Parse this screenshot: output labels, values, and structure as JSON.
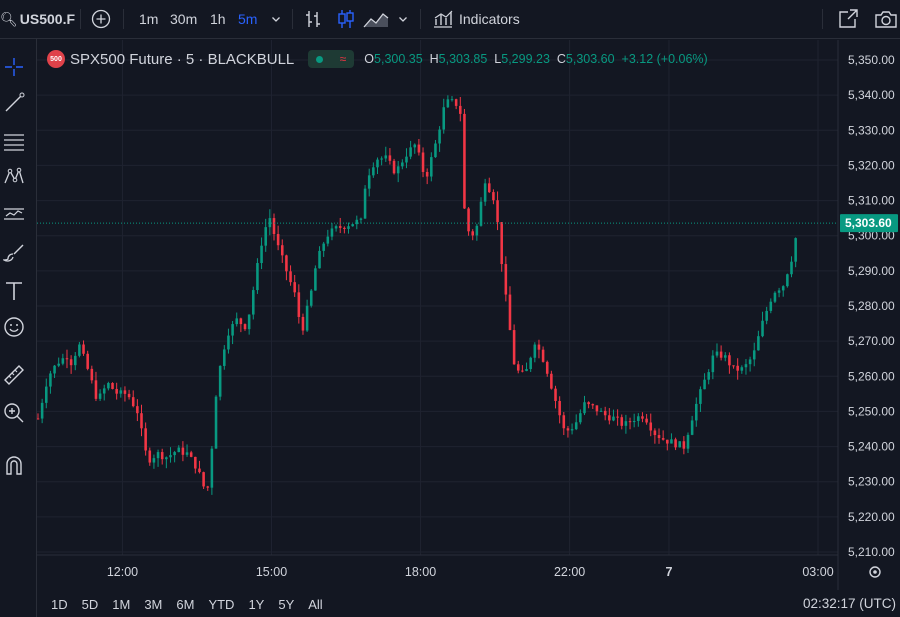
{
  "toolbar": {
    "symbol": "US500.F",
    "intervals": [
      "1m",
      "30m",
      "1h",
      "5m"
    ],
    "active_interval": "5m",
    "indicators_label": "Indicators"
  },
  "legend": {
    "symbol_badge": "500",
    "title": "SPX500 Future · 5 · BLACKBULL",
    "open_key": "O",
    "open": "5,300.35",
    "high_key": "H",
    "high": "5,303.85",
    "low_key": "L",
    "low": "5,299.23",
    "close_key": "C",
    "close": "5,303.60",
    "change": "+3.12 (+0.06%)"
  },
  "bottom": {
    "ranges": [
      "1D",
      "5D",
      "1M",
      "3M",
      "6M",
      "YTD",
      "1Y",
      "5Y",
      "All"
    ],
    "clock": "02:32:17 (UTC)"
  },
  "colors": {
    "background": "#131722",
    "up": "#089981",
    "down": "#f23645",
    "grid": "#1f2330",
    "text": "#d1d4dc",
    "price_tag": "#089981"
  },
  "chart_data": {
    "type": "candlestick",
    "title": "SPX500 Future · 5 · BLACKBULL",
    "current_price": 5303.6,
    "current_price_label": "5,303.60",
    "ylim": [
      5210,
      5350
    ],
    "y_ticks": [
      5350,
      5340,
      5330,
      5320,
      5310,
      5300,
      5290,
      5280,
      5270,
      5260,
      5250,
      5240,
      5230,
      5220,
      5210
    ],
    "y_tick_labels": [
      "5,350.00",
      "5,340.00",
      "5,330.00",
      "5,320.00",
      "5,310.00",
      "5,300.00",
      "5,290.00",
      "5,280.00",
      "5,270.00",
      "5,260.00",
      "5,250.00",
      "5,240.00",
      "5,230.00",
      "5,220.00",
      "5,210.00"
    ],
    "x_ticks": [
      {
        "label": "12:00",
        "t": 12.0
      },
      {
        "label": "15:00",
        "t": 15.0
      },
      {
        "label": "18:00",
        "t": 18.0
      },
      {
        "label": "22:00",
        "t": 21.0
      },
      {
        "label": "7",
        "t": 23.0
      },
      {
        "label": "03:00",
        "t": 26.0
      }
    ],
    "x_range": [
      10.3,
      26.0
    ],
    "close_path": [
      [
        10.3,
        5248
      ],
      [
        10.5,
        5260
      ],
      [
        10.7,
        5264
      ],
      [
        10.9,
        5266
      ],
      [
        11.0,
        5263
      ],
      [
        11.1,
        5270
      ],
      [
        11.3,
        5262
      ],
      [
        11.5,
        5253
      ],
      [
        11.7,
        5258
      ],
      [
        11.9,
        5255
      ],
      [
        12.1,
        5255
      ],
      [
        12.3,
        5250
      ],
      [
        12.5,
        5236
      ],
      [
        12.7,
        5238
      ],
      [
        12.9,
        5237
      ],
      [
        13.1,
        5239
      ],
      [
        13.3,
        5238
      ],
      [
        13.5,
        5234
      ],
      [
        13.7,
        5226
      ],
      [
        13.8,
        5240
      ],
      [
        13.9,
        5258
      ],
      [
        14.1,
        5272
      ],
      [
        14.3,
        5276
      ],
      [
        14.5,
        5274
      ],
      [
        14.7,
        5290
      ],
      [
        14.8,
        5298
      ],
      [
        14.95,
        5306
      ],
      [
        15.1,
        5298
      ],
      [
        15.3,
        5290
      ],
      [
        15.5,
        5282
      ],
      [
        15.6,
        5272
      ],
      [
        15.7,
        5278
      ],
      [
        15.8,
        5284
      ],
      [
        15.9,
        5292
      ],
      [
        16.1,
        5300
      ],
      [
        16.3,
        5302
      ],
      [
        16.5,
        5303
      ],
      [
        16.7,
        5304
      ],
      [
        16.8,
        5304
      ],
      [
        16.9,
        5316
      ],
      [
        17.1,
        5322
      ],
      [
        17.3,
        5322
      ],
      [
        17.5,
        5318
      ],
      [
        17.7,
        5323
      ],
      [
        17.9,
        5326
      ],
      [
        18.1,
        5316
      ],
      [
        18.3,
        5326
      ],
      [
        18.5,
        5338
      ],
      [
        18.7,
        5338
      ],
      [
        18.8,
        5335
      ],
      [
        18.9,
        5302
      ],
      [
        19.1,
        5300
      ],
      [
        19.3,
        5316
      ],
      [
        19.5,
        5310
      ],
      [
        19.7,
        5284
      ],
      [
        19.9,
        5262
      ],
      [
        20.1,
        5260
      ],
      [
        20.3,
        5270
      ],
      [
        20.5,
        5264
      ],
      [
        20.7,
        5254
      ],
      [
        20.9,
        5244
      ],
      [
        21.1,
        5246
      ],
      [
        21.3,
        5252
      ],
      [
        21.5,
        5251
      ],
      [
        21.7,
        5249
      ],
      [
        21.9,
        5248
      ],
      [
        22.1,
        5246
      ],
      [
        22.3,
        5248
      ],
      [
        22.5,
        5249
      ],
      [
        22.7,
        5244
      ],
      [
        22.9,
        5242
      ],
      [
        23.1,
        5241
      ],
      [
        23.3,
        5240
      ],
      [
        23.5,
        5250
      ],
      [
        23.7,
        5258
      ],
      [
        23.9,
        5266
      ],
      [
        24.1,
        5266
      ],
      [
        24.3,
        5262
      ],
      [
        24.5,
        5262
      ],
      [
        24.7,
        5266
      ],
      [
        24.9,
        5276
      ],
      [
        25.1,
        5284
      ],
      [
        25.3,
        5286
      ],
      [
        25.5,
        5295
      ],
      [
        25.6,
        5303.6
      ]
    ]
  }
}
